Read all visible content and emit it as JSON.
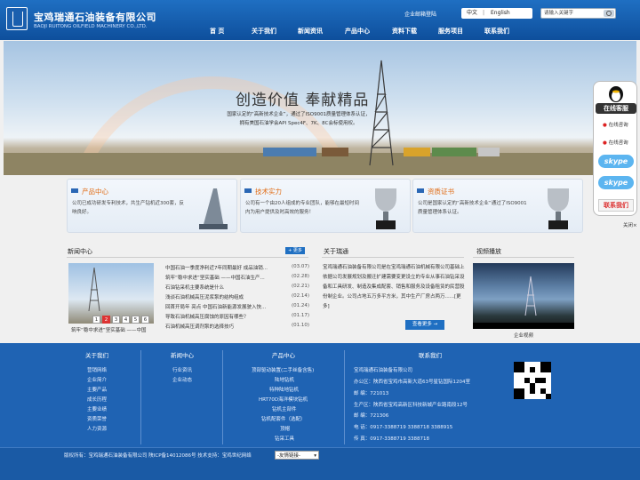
{
  "header": {
    "logo_cn": "宝鸡瑞通石油装备有限公司",
    "logo_en": "BAOJI RUITONG OILFIELD MACHINERY CO.,LTD.",
    "mail_link": "企业邮箱登陆",
    "lang_cn": "中文",
    "lang_sep": "|",
    "lang_en": "English",
    "search_placeholder": "请输入关键字",
    "nav": [
      "首 页",
      "关于我们",
      "新闻资讯",
      "产品中心",
      "资料下载",
      "服务项目",
      "联系我们"
    ]
  },
  "banner": {
    "slogan": "创造价值 奉献精品",
    "sub1": "国家认定的“高新技术企业”，通过了ISO9001质量管理体系认证，",
    "sub2": "拥有美国石油学会API Spec4F、7K、8C会标使用权。"
  },
  "float_service": {
    "title": "在线客服",
    "qq1": "在线咨询",
    "qq2": "在线咨询",
    "skype1": "skype",
    "skype2": "skype",
    "contact": "联系我们",
    "close": "关闭×"
  },
  "cards": [
    {
      "title": "产品中心",
      "text": "公司已成功研发专利技术，共生产钻机近300套，反响良好。"
    },
    {
      "title": "技术实力",
      "text": "公司有一个由20人组成的专业团队，能够在最短时间内为用户提供及时高效的服务！"
    },
    {
      "title": "资质证书",
      "text": "公司是国家认定的“高新技术企业”通过了ISO9001质量管理体系认证。"
    }
  ],
  "news": {
    "title": "新闻中心",
    "more": "+ 更多",
    "caption": "筑牢“稳中求进”坚实基础 ——中国",
    "pages": [
      "1",
      "2",
      "3",
      "4",
      "5",
      "6"
    ],
    "items": [
      {
        "t": "中国石油一季度净利近7年同期最好 成品油销...",
        "d": "(03.07)"
      },
      {
        "t": "筑牢“稳中求进”坚实基础 ——中国石油生产...",
        "d": "(02.28)"
      },
      {
        "t": "石油钻采机主要系统是什么",
        "d": "(02.21)"
      },
      {
        "t": "浅谈石油机械高压泥浆泵的结构组成",
        "d": "(02.14)"
      },
      {
        "t": "回首开局年 亮点 中国石油新能源发展驶入快...",
        "d": "(01.24)"
      },
      {
        "t": "导致石油机械高压腐蚀的原因有哪些？",
        "d": "(01.17)"
      },
      {
        "t": "石油机械高压调剂泵的选择技巧",
        "d": "(01.10)"
      }
    ]
  },
  "about": {
    "title": "关于瑞通",
    "text": "宝鸡瑞通石油装备有限公司是在宝鸡瑞通石油机械有限公司基础上依据公司发展规划及搬迁扩建需要变更设立的专业从事石油钻采设备和工具研发、制造及集成配套、销售和服务及设备租赁的民营股份制企业。公司占地五万多平方米，其中生产厂房占两万......[更多]",
    "button": "查看更多 →"
  },
  "video": {
    "title": "视频播放",
    "caption": "企业视频"
  },
  "footer": {
    "about_title": "关于我们",
    "about_items": [
      "营销网络",
      "企业简介",
      "主要产品",
      "成长历程",
      "主要业绩",
      "资质荣誉",
      "人力资源"
    ],
    "news_title": "新闻中心",
    "news_items": [
      "行业资讯",
      "企业动态"
    ],
    "prod_title": "产品中心",
    "prod_items": [
      "顶部驱动装置(二手丝备含售)",
      "陆地钻机",
      "特种陆地钻机",
      "HRT70D海洋模块钻机",
      "钻机主部件",
      "钻机配套件（选配）",
      "顶帽",
      "钻采工具"
    ],
    "contact_title": "联系我们",
    "contact_items": [
      "宝鸡瑞通石油装备有限公司",
      "办公区：陕西省宝鸡市高新大道63号星钻国际1204室",
      "邮 编：721013",
      "生产区：陕西省宝鸡高新区科技新城产业路南段12号",
      "邮 编：721306",
      "电 话：0917-3388719 3388718 3388915",
      "传 真：0917-3388719 3388718"
    ],
    "copyright": "版权所有：宝鸡瑞通石油装备有限公司 陕ICP备14012086号  技术支持：宝鸡世纪网络",
    "select": "-友情链接-"
  }
}
